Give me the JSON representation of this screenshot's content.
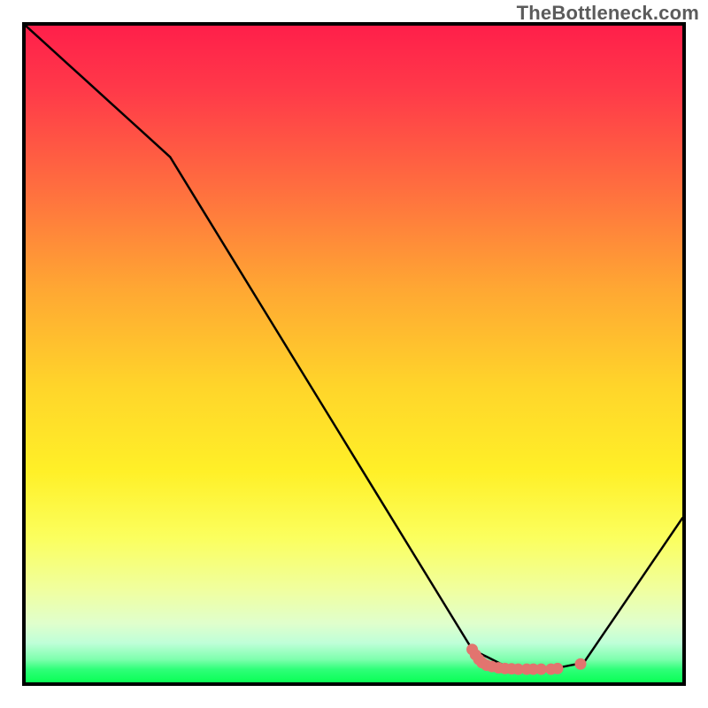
{
  "watermark": "TheBottleneck.com",
  "chart_data": {
    "type": "line",
    "title": "",
    "xlabel": "",
    "ylabel": "",
    "xlim": [
      0,
      100
    ],
    "ylim": [
      0,
      100
    ],
    "series": [
      {
        "name": "bottleneck-curve",
        "x": [
          0,
          22,
          68,
          74,
          80,
          85,
          100
        ],
        "values": [
          100,
          80,
          5,
          2,
          2,
          3,
          25
        ]
      }
    ],
    "markers": {
      "name": "highlighted-dots",
      "color": "#e2746f",
      "points": [
        {
          "x": 68.0,
          "y": 5.0
        },
        {
          "x": 68.5,
          "y": 4.2
        },
        {
          "x": 69.0,
          "y": 3.5
        },
        {
          "x": 69.5,
          "y": 3.0
        },
        {
          "x": 70.2,
          "y": 2.6
        },
        {
          "x": 71.0,
          "y": 2.4
        },
        {
          "x": 72.0,
          "y": 2.2
        },
        {
          "x": 73.0,
          "y": 2.1
        },
        {
          "x": 74.0,
          "y": 2.05
        },
        {
          "x": 75.0,
          "y": 2.0
        },
        {
          "x": 76.3,
          "y": 2.0
        },
        {
          "x": 77.3,
          "y": 2.0
        },
        {
          "x": 78.5,
          "y": 2.0
        },
        {
          "x": 80.0,
          "y": 2.0
        },
        {
          "x": 81.0,
          "y": 2.1
        },
        {
          "x": 84.5,
          "y": 2.8
        }
      ]
    }
  }
}
